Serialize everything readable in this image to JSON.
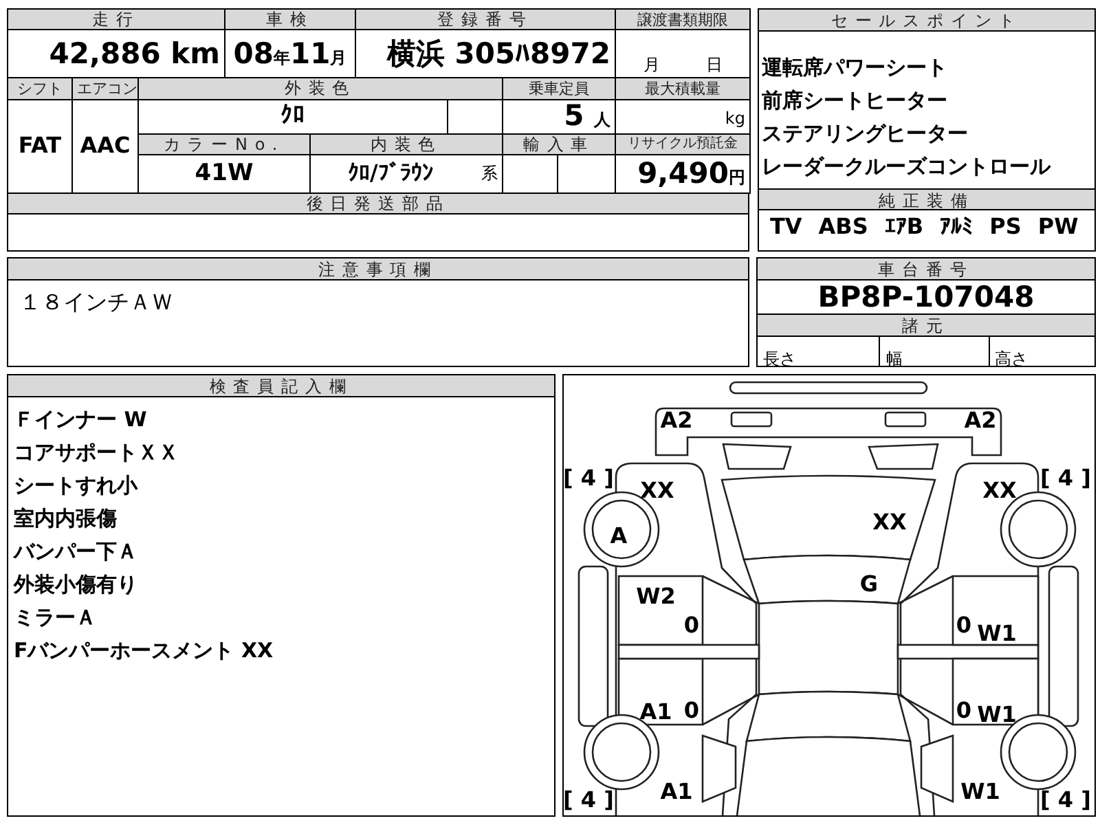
{
  "info": {
    "mileage_label": "走行",
    "mileage_value": "42,886",
    "mileage_unit": "km",
    "inspection_label": "車検",
    "inspection_year": "08",
    "year_unit": "年",
    "inspection_month": "11",
    "month_unit": "月",
    "registration_label": "登録番号",
    "registration_value": "横浜 305ﾊ8972",
    "transfer_label": "譲渡書類期限",
    "transfer_month_unit": "月",
    "transfer_day_unit": "日",
    "shift_label": "シフト",
    "shift_value": "FAT",
    "ac_label": "エアコン",
    "ac_value": "AAC",
    "exterior_color_label": "外装色",
    "exterior_color_value": "ｸﾛ",
    "capacity_label": "乗車定員",
    "capacity_value": "5",
    "capacity_unit": "人",
    "max_load_label": "最大積載量",
    "max_load_unit": "kg",
    "color_no_label": "カラーNo.",
    "color_no_value": "41W",
    "interior_color_label": "内装色",
    "interior_color_value": "ｸﾛ/ﾌﾞﾗｳﾝ",
    "interior_color_suffix": "系",
    "import_label": "輸入車",
    "recycle_label": "リサイクル預託金",
    "recycle_value": "9,490",
    "recycle_unit": "円",
    "parts_label": "後日発送部品"
  },
  "sale_points": {
    "label": "セールスポイント",
    "items": [
      "運転席パワーシート",
      "前席シートヒーター",
      "ステアリングヒーター",
      "レーダークルーズコントロール"
    ]
  },
  "equipment": {
    "label": "純正装備",
    "items": [
      "TV",
      "ABS",
      "ｴｱB",
      "ｱﾙﾐ",
      "PS",
      "PW"
    ]
  },
  "notes": {
    "label": "注意事項欄",
    "text": "１８インチＡＷ"
  },
  "chassis": {
    "label": "車台番号",
    "value": "BP8P-107048",
    "specs_label": "諸元",
    "specs": [
      "長さ",
      "幅",
      "高さ"
    ]
  },
  "inspector": {
    "label": "検査員記入欄",
    "lines": [
      "Ｆインナー W",
      "コアサポートＸＸ",
      "シートすれ小",
      "室内内張傷",
      "バンパー下Ａ",
      "外装小傷有り",
      "ミラーＡ",
      "Fバンパーホースメント XX"
    ]
  },
  "diagram_marks": [
    "A2",
    "A2",
    "[ 4 ]",
    "[ 4 ]",
    "XX",
    "XX",
    "XX",
    "A",
    "G",
    "W2",
    "0",
    "0",
    "W1",
    "A1",
    "0",
    "0",
    "W1",
    "[ 4 ]",
    "A1",
    "W1",
    "[ 4 ]"
  ]
}
